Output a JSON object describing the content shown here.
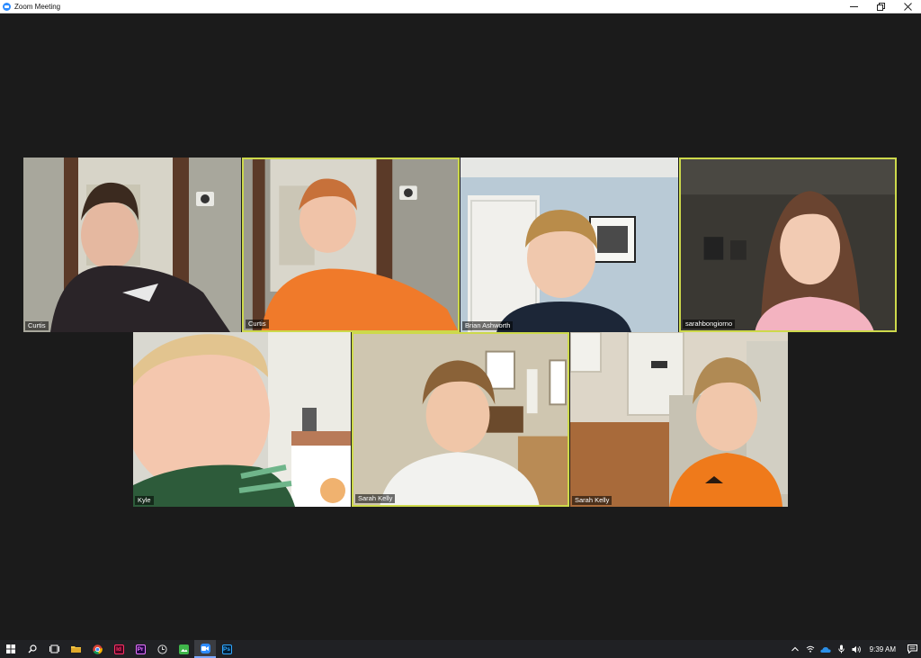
{
  "window": {
    "title": "Zoom Meeting",
    "controls": [
      "minimize",
      "restore",
      "close"
    ]
  },
  "participants": [
    {
      "name": "Curtis",
      "speaking": false,
      "scene": "kitchen-doorway",
      "shirt_color": "#2a2428"
    },
    {
      "name": "Curtis",
      "speaking": true,
      "scene": "kitchen-doorway",
      "shirt_color": "#f07a2a"
    },
    {
      "name": "Brian Ashworth",
      "speaking": false,
      "scene": "blue-wall-door",
      "shirt_color": "#1c2637"
    },
    {
      "name": "sarahbongiorno",
      "speaking": true,
      "scene": "dark-room",
      "shirt_color": "#f3b3c0"
    },
    {
      "name": "Kyle",
      "speaking": false,
      "scene": "stairway",
      "shirt_color": "#2d5b3a"
    },
    {
      "name": "Sarah Kelly",
      "speaking": true,
      "scene": "living-room-window",
      "shirt_color": "#f2f2ef"
    },
    {
      "name": "Sarah Kelly",
      "speaking": false,
      "scene": "couch-front-door",
      "shirt_color": "#ef7a1b"
    }
  ],
  "taskbar": {
    "apps": [
      {
        "icon": "windows-start-icon",
        "label": ""
      },
      {
        "icon": "search-icon",
        "label": ""
      },
      {
        "icon": "task-view-icon",
        "label": ""
      },
      {
        "icon": "file-explorer-icon",
        "label": ""
      },
      {
        "icon": "chrome-icon",
        "label": ""
      },
      {
        "icon": "indesign-icon",
        "label": "Id"
      },
      {
        "icon": "premiere-icon",
        "label": "Pr"
      },
      {
        "icon": "clock-app-icon",
        "label": ""
      },
      {
        "icon": "photos-app-icon",
        "label": ""
      },
      {
        "icon": "zoom-icon",
        "label": ""
      },
      {
        "icon": "photoshop-icon",
        "label": "Ps"
      }
    ],
    "tray": [
      "chevron-up-icon",
      "wifi-icon",
      "onedrive-icon",
      "microphone-icon",
      "volume-icon"
    ],
    "time": "9:39 AM",
    "notification_icon": "action-center-icon"
  },
  "colors": {
    "active_speaker_border": "#cdd94b",
    "zoom_blue": "#2d8cff",
    "stage_background": "#1b1b1b"
  }
}
